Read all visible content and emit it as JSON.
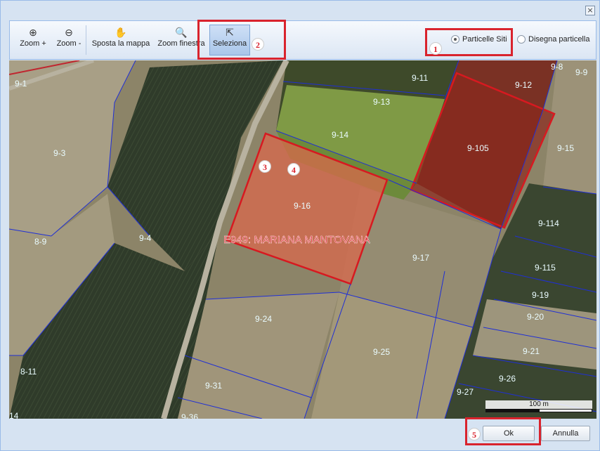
{
  "toolbar": {
    "zoom_in": "Zoom +",
    "zoom_out": "Zoom -",
    "pan": "Sposta la mappa",
    "zoom_window": "Zoom finestra",
    "select": "Seleziona"
  },
  "mode_options": [
    {
      "label": "Particelle Siti",
      "selected": true
    },
    {
      "label": "Disegna particella",
      "selected": false
    }
  ],
  "map": {
    "highlighted_parcels": [
      "9-105",
      "9-16"
    ],
    "parcel_labels": [
      "9-1",
      "9-3",
      "9-4",
      "8-9",
      "8-11",
      "14",
      "9-11",
      "9-8",
      "9-9",
      "9-12",
      "9-13",
      "9-14",
      "9-105",
      "9-15",
      "9-16",
      "9-114",
      "9-17",
      "9-115",
      "9-19",
      "9-20",
      "9-21",
      "9-24",
      "9-25",
      "9-26",
      "9-27",
      "9-31",
      "9-36"
    ],
    "municipality_label": "E949: MARIANA MANTOVANA",
    "scale_label": "100 m"
  },
  "annotations": [
    "1",
    "2",
    "3",
    "4",
    "5"
  ],
  "footer": {
    "ok": "Ok",
    "cancel": "Annulla"
  },
  "colors": {
    "annotation_red": "#d9232d",
    "parcel_line": "#1f2fd6",
    "selected_fill": "#c24a3a"
  }
}
